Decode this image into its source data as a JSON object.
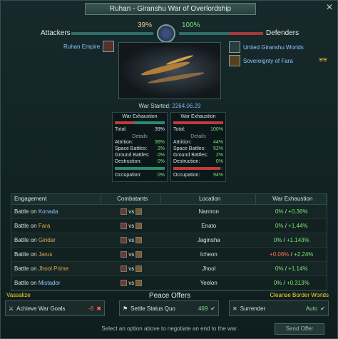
{
  "title": "Ruhan - Giranshu War of Overlordship",
  "close_icon": "close-icon",
  "attackers_label": "Attackers",
  "defenders_label": "Defenders",
  "attackers_pct": "39%",
  "defenders_pct": "100%",
  "attacker_faction": "Ruhan Empire",
  "defender_factions": [
    "United Giranshu Worlds",
    "Sovereignty of Fara"
  ],
  "war_started_label": "War Started:",
  "war_started_value": "2264.06.29",
  "exhaustion_left": {
    "title": "War Exhaustion",
    "total_label": "Total:",
    "total": "39%",
    "details_label": "Details",
    "attrition_label": "Attrition:",
    "attrition": "36%",
    "space_label": "Space Battles:",
    "space": "2%",
    "ground_label": "Ground Battles:",
    "ground": "0%",
    "destruction_label": "Destruction:",
    "destruction": "0%",
    "occupation_label": "Occupation:",
    "occupation": "0%"
  },
  "exhaustion_right": {
    "title": "War Exhaustion",
    "total_label": "Total:",
    "total": "100%",
    "details_label": "Details",
    "attrition_label": "Attrition:",
    "attrition": "44%",
    "space_label": "Space Battles:",
    "space": "52%",
    "ground_label": "Ground Battles:",
    "ground": "2%",
    "destruction_label": "Destruction:",
    "destruction": "0%",
    "occupation_label": "Occupation:",
    "occupation": "94%"
  },
  "table": {
    "headers": [
      "Engagement",
      "Combatants",
      "Location",
      "War Exhaustion"
    ],
    "rows": [
      {
        "prefix": "Battle on",
        "planet": "Konada",
        "vs": "vs",
        "location": "Namron",
        "ex_a": "0%",
        "sep": " / ",
        "ex_b": "+0.36%"
      },
      {
        "prefix": "Battle on",
        "planet": "Fara",
        "vs": "vs",
        "location": "Enato",
        "ex_a": "0%",
        "sep": " / ",
        "ex_b": "+1.44%"
      },
      {
        "prefix": "Battle on",
        "planet": "Giridar",
        "vs": "vs",
        "location": "Jaginsha",
        "ex_a": "0%",
        "sep": " / ",
        "ex_b": "+1.143%"
      },
      {
        "prefix": "Battle on",
        "planet": "Jarus",
        "vs": "vs",
        "location": "Icheon",
        "ex_a": "+0.06%",
        "sep": " / ",
        "ex_b": "+2.24%"
      },
      {
        "prefix": "Battle on",
        "planet": "Jhool Prime",
        "vs": "vs",
        "location": "Jhool",
        "ex_a": "0%",
        "sep": " / ",
        "ex_b": "+1.14%"
      },
      {
        "prefix": "Battle on",
        "planet": "Mistador",
        "vs": "vs",
        "location": "Yeelon",
        "ex_a": "0%",
        "sep": " / ",
        "ex_b": "+0.313%"
      }
    ]
  },
  "peace_offers_title": "Peace Offers",
  "vassalize_label": "Vassalize",
  "cleanse_label": "Cleanse Border Worlds",
  "offers": [
    {
      "label": "Achieve War Goals",
      "cost": "-6"
    },
    {
      "label": "Settle Status Quo",
      "cost": "469"
    },
    {
      "label": "Surrender",
      "cost": "Auto"
    }
  ],
  "hint": "Select an option above to negotiate an end to the war.",
  "send_offer": "Send Offer"
}
